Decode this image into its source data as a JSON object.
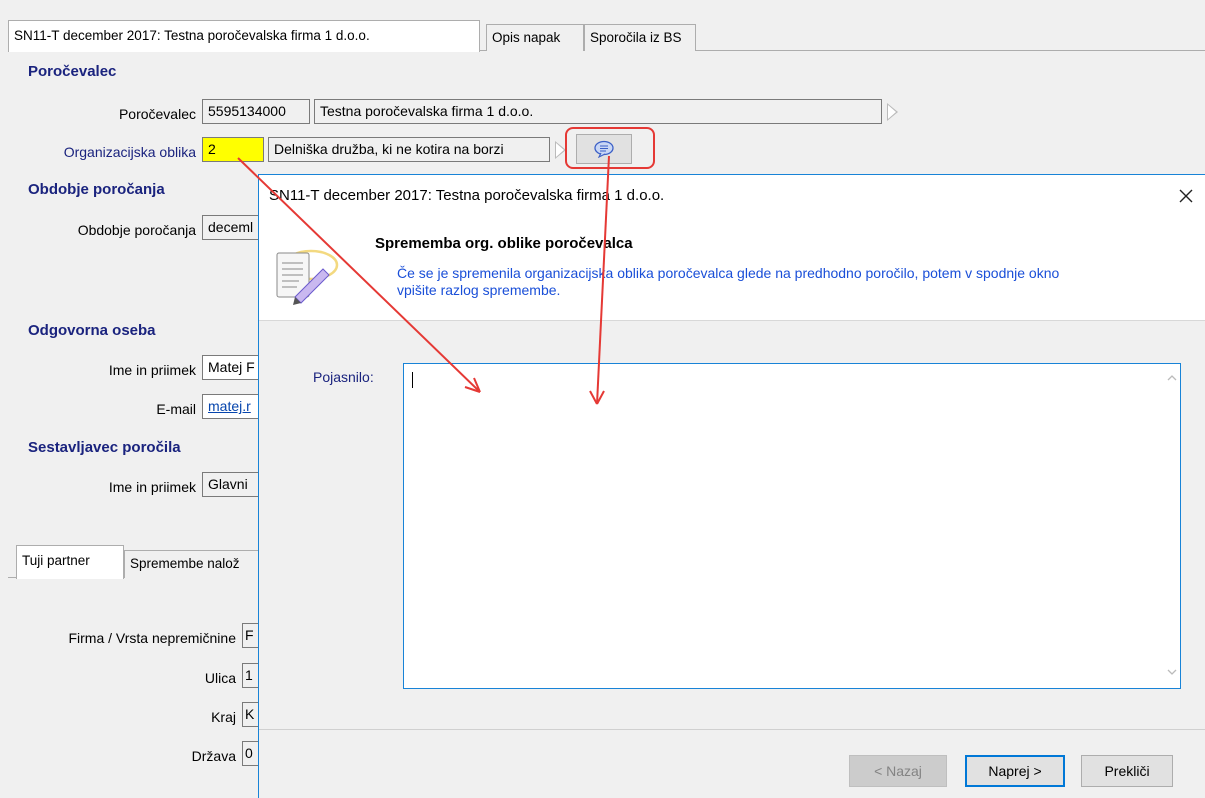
{
  "main_tabs": [
    {
      "label": "SN11-T december 2017: Testna poročevalska firma 1 d.o.o.",
      "active": true
    },
    {
      "label": "Opis napak",
      "active": false
    },
    {
      "label": "Sporočila iz BS",
      "active": false
    }
  ],
  "porocevalec_section": {
    "heading": "Poročevalec",
    "reporter_label": "Poročevalec",
    "reporter_id": "5595134000",
    "reporter_name": "Testna poročevalska firma 1 d.o.o.",
    "org_form_label": "Organizacijska oblika",
    "org_form_code": "2",
    "org_form_text": "Delniška družba, ki ne kotira na borzi"
  },
  "obdobje_section": {
    "heading": "Obdobje poročanja",
    "label": "Obdobje poročanja",
    "value": "deceml"
  },
  "odgovorna_section": {
    "heading": "Odgovorna oseba",
    "name_label": "Ime in priimek",
    "name_value": "Matej F",
    "email_label": "E-mail",
    "email_value": "matej.r"
  },
  "sestavljavec_section": {
    "heading": "Sestavljavec poročila",
    "name_label": "Ime in priimek",
    "name_value": "Glavni"
  },
  "bottom_tabs": [
    {
      "label": "Tuji partner",
      "active": true
    },
    {
      "label": "Spremembe nalož",
      "active": false
    }
  ],
  "partner_section": {
    "firma_label": "Firma / Vrsta nepremičnine",
    "firma_value": "F",
    "ulica_label": "Ulica",
    "ulica_value": "1",
    "kraj_label": "Kraj",
    "kraj_value": "K",
    "drzava_label": "Država",
    "drzava_value": "0"
  },
  "dialog": {
    "title": "SN11-T december 2017: Testna poročevalska firma 1 d.o.o.",
    "header_title": "Sprememba org. oblike poročevalca",
    "header_description_line1": "Če se je spremenila organizacijska oblika poročevalca glede na predhodno poročilo, potem v spodnje okno",
    "header_description_line2": "vpišite razlog spremembe.",
    "field_label": "Pojasnilo:",
    "field_value": "",
    "back_button": "< Nazaj",
    "next_button": "Naprej >",
    "cancel_button": "Prekliči"
  },
  "colors": {
    "heading": "#1a237e",
    "highlight_field": "#ffff00",
    "annotation": "#e53935",
    "dialog_border": "#1883d7"
  }
}
